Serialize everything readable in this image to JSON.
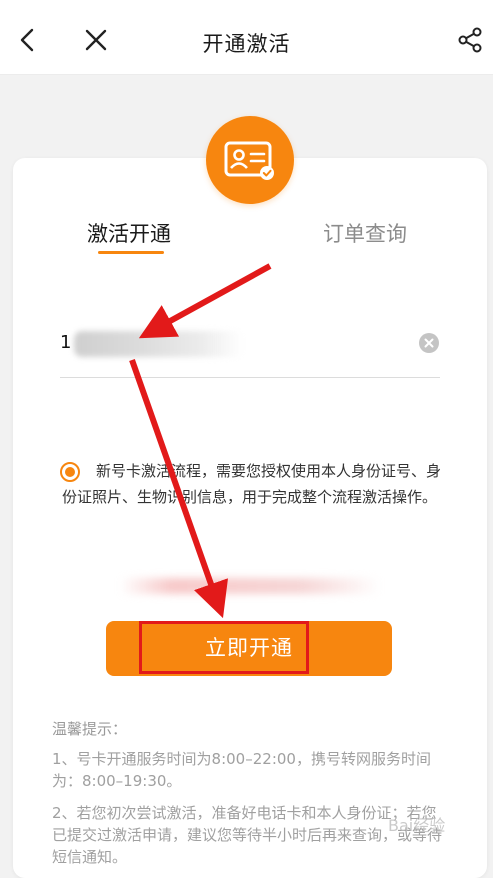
{
  "header": {
    "title": "开通激活",
    "icons": [
      "back-arrow-icon",
      "close-icon",
      "share-icon"
    ]
  },
  "badge": {
    "icon": "id-card-icon"
  },
  "tabs": [
    {
      "label": "激活开通",
      "active": true
    },
    {
      "label": "订单查询",
      "active": false
    }
  ],
  "phone": {
    "visible_value": "1"
  },
  "consent": {
    "checked": true,
    "text": "新号卡激活流程，需要您授权使用本人身份证号、身份证照片、生物识别信息，用于完成整个流程激活操作。"
  },
  "activate_button": {
    "label": "立即开通"
  },
  "tips": {
    "title": "温馨提示：",
    "items": [
      "1、号卡开通服务时间为8:00–22:00，携号转网服务时间为：8:00–19:30。",
      "2、若您初次尝试激活，准备好电话卡和本人身份证；若您已提交过激活申请，建议您等待半小时后再来查询，或等待短信通知。"
    ]
  },
  "watermark": {
    "text": "Bai经验"
  },
  "colors": {
    "accent": "#f7860f",
    "annotation_red": "#e21a1a",
    "background": "#f2f2f2"
  }
}
